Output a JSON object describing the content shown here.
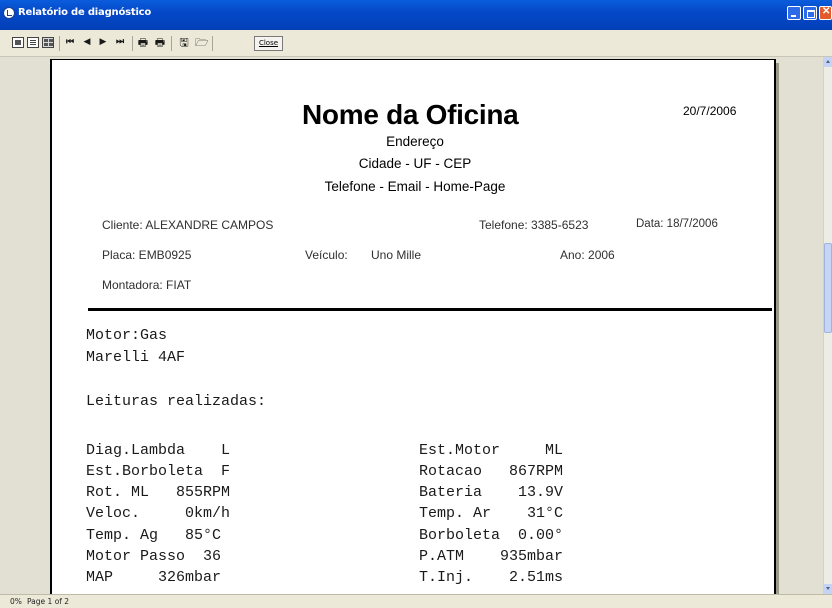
{
  "window": {
    "title": "Relatório de diagnóstico"
  },
  "toolbar": {
    "close_label": "Close"
  },
  "status": {
    "progress": "0%",
    "page": "Page 1 of 2"
  },
  "report": {
    "shop_name": "Nome da Oficina",
    "address": "Endereço",
    "city_line": "Cidade - UF - CEP",
    "contact_line": "Telefone - Email - Home-Page",
    "print_date": "20/7/2006",
    "client": "Cliente: ALEXANDRE CAMPOS",
    "telephone": "Telefone: 3385-6523",
    "date": "Data: 18/7/2006",
    "plate": "Placa: EMB0925",
    "vehicle_label": "Veículo:",
    "vehicle_value": "Uno Mille",
    "year": "Ano: 2006",
    "manufacturer": "Montadora:  FIAT",
    "engine": "Motor:Gas",
    "ecu": "Marelli 4AF",
    "readings_title": "Leituras realizadas:",
    "readings_left": [
      "Diag.Lambda    L",
      "Est.Borboleta  F",
      "Rot. ML   855RPM",
      "Veloc.     0km/h",
      "Temp. Ag   85°C",
      "Motor Passo  36",
      "MAP     326mbar"
    ],
    "readings_right": [
      "Est.Motor     ML",
      "Rotacao   867RPM",
      "Bateria    13.9V",
      "Temp. Ar    31°C",
      "Borboleta  0.00°",
      "P.ATM    935mbar",
      "T.Inj.    2.51ms"
    ]
  }
}
